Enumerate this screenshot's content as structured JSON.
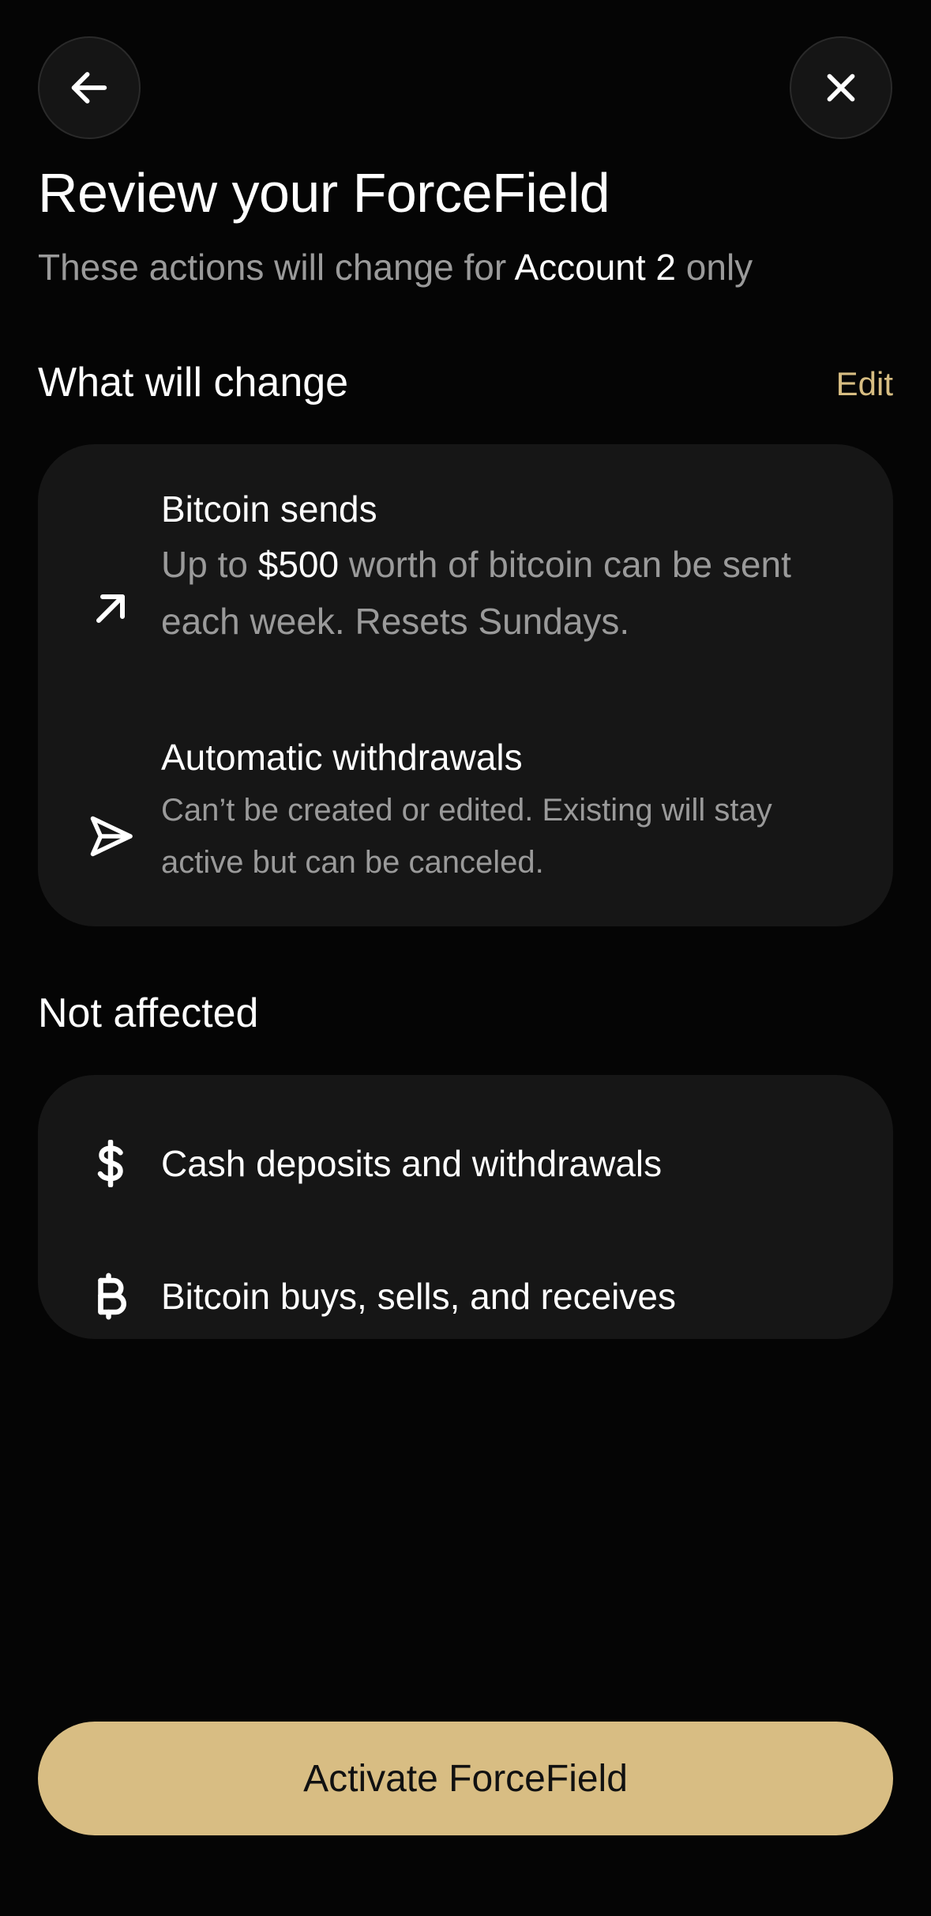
{
  "nav": {
    "back_icon": "arrow-left-icon",
    "close_icon": "close-icon"
  },
  "header": {
    "title": "Review your ForceField",
    "subtitle_prefix": "These actions will change for ",
    "subtitle_account": "Account 2",
    "subtitle_suffix": " only"
  },
  "changes": {
    "heading": "What will change",
    "edit_label": "Edit",
    "items": [
      {
        "icon": "arrow-up-right-icon",
        "title": "Bitcoin sends",
        "desc_prefix": "Up to ",
        "desc_amount": "$500",
        "desc_suffix": " worth of bitcoin can be sent each week. Resets Sundays."
      },
      {
        "icon": "send-icon",
        "title": "Automatic withdrawals",
        "desc": "Can’t be created or edited. Existing will stay active but can be canceled."
      }
    ]
  },
  "not_affected": {
    "heading": "Not affected",
    "items": [
      {
        "icon": "dollar-icon",
        "title": "Cash deposits and withdrawals"
      },
      {
        "icon": "bitcoin-icon",
        "title": "Bitcoin buys, sells, and receives"
      }
    ]
  },
  "cta": {
    "label": "Activate ForceField"
  },
  "colors": {
    "accent": "#d8bd83",
    "background": "#050505",
    "card": "#161616",
    "muted": "#9a9a9a"
  }
}
